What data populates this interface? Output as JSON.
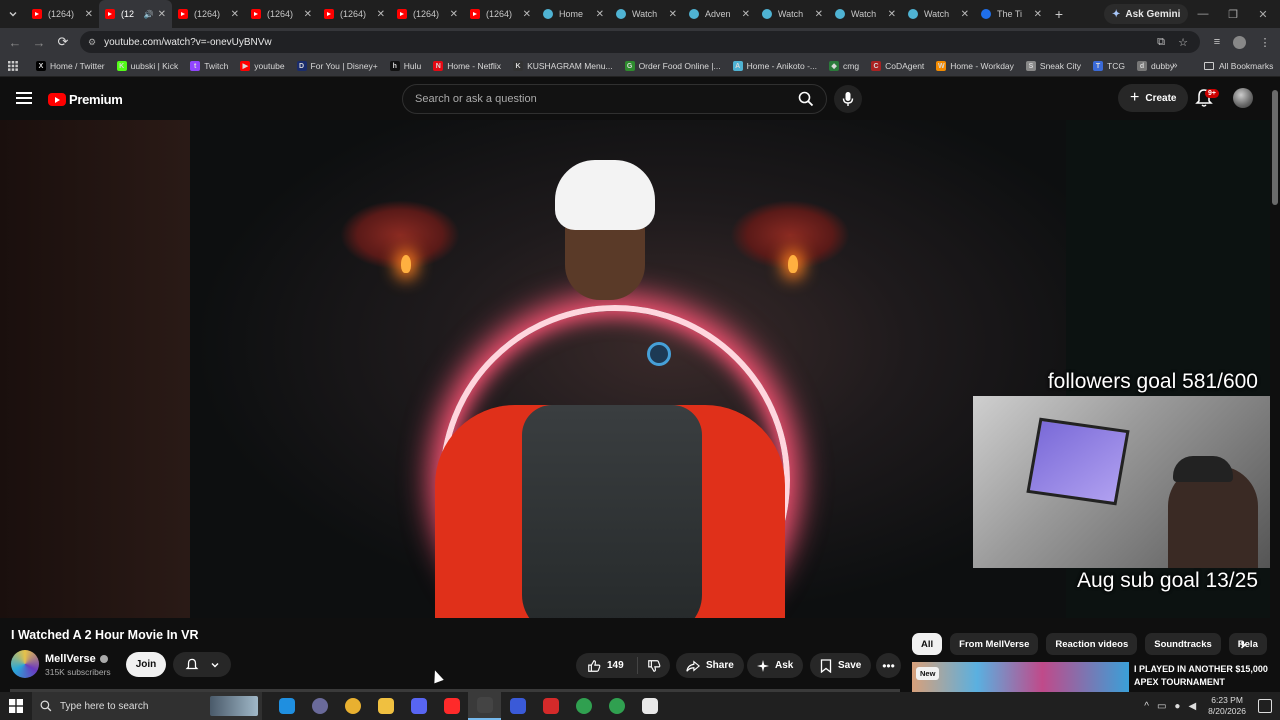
{
  "browser": {
    "tabs": [
      {
        "label": "(1264)",
        "favicon": "youtube-icon",
        "active": false
      },
      {
        "label": "(12",
        "favicon": "youtube-icon",
        "active": true,
        "audio": true
      },
      {
        "label": "(1264)",
        "favicon": "youtube-icon",
        "active": false
      },
      {
        "label": "(1264)",
        "favicon": "youtube-icon",
        "active": false
      },
      {
        "label": "(1264)",
        "favicon": "youtube-icon",
        "active": false
      },
      {
        "label": "(1264)",
        "favicon": "youtube-icon",
        "active": false
      },
      {
        "label": "(1264)",
        "favicon": "youtube-icon",
        "active": false
      },
      {
        "label": "Home",
        "favicon": "watch-icon",
        "active": false
      },
      {
        "label": "Watch",
        "favicon": "watch-icon",
        "active": false
      },
      {
        "label": "Adven",
        "favicon": "watch-icon",
        "active": false
      },
      {
        "label": "Watch",
        "favicon": "watch-icon",
        "active": false
      },
      {
        "label": "Watch",
        "favicon": "watch-icon",
        "active": false
      },
      {
        "label": "Watch",
        "favicon": "watch-icon",
        "active": false
      },
      {
        "label": "The Ti",
        "favicon": "facebook-icon",
        "active": false
      }
    ],
    "new_tab": "+",
    "gemini_label": "Ask Gemini",
    "url": "youtube.com/watch?v=-onevUyBNVw",
    "bookmarks": [
      {
        "label": "Home / Twitter",
        "icon": "x-icon",
        "color": "#000000",
        "glyph": "X"
      },
      {
        "label": "uubski | Kick",
        "icon": "kick-icon",
        "color": "#53fc18",
        "glyph": "K"
      },
      {
        "label": "Twitch",
        "icon": "twitch-icon",
        "color": "#9146ff",
        "glyph": "t"
      },
      {
        "label": "youtube",
        "icon": "youtube-icon",
        "color": "#ff0000",
        "glyph": "▶"
      },
      {
        "label": "For You | Disney+",
        "icon": "disney-icon",
        "color": "#1a2c6b",
        "glyph": "D"
      },
      {
        "label": "Hulu",
        "icon": "hulu-icon",
        "color": "#111111",
        "glyph": "h"
      },
      {
        "label": "Home - Netflix",
        "icon": "netflix-icon",
        "color": "#e50914",
        "glyph": "N"
      },
      {
        "label": "KUSHAGRAM Menu...",
        "icon": "kushagram-icon",
        "color": "#333333",
        "glyph": "K"
      },
      {
        "label": "Order Food Online |...",
        "icon": "grubhub-icon",
        "color": "#2e8b2e",
        "glyph": "G"
      },
      {
        "label": "Home - Anikoto -...",
        "icon": "anikoto-icon",
        "color": "#4fb3d3",
        "glyph": "A"
      },
      {
        "label": "cmg",
        "icon": "cmg-icon",
        "color": "#2a7a3a",
        "glyph": "◆"
      },
      {
        "label": "CoDAgent",
        "icon": "codagent-icon",
        "color": "#aa2222",
        "glyph": "C"
      },
      {
        "label": "Home - Workday",
        "icon": "workday-icon",
        "color": "#f38b00",
        "glyph": "W"
      },
      {
        "label": "Sneak City",
        "icon": "sneakcity-icon",
        "color": "#888888",
        "glyph": "S"
      },
      {
        "label": "TCG",
        "icon": "tcg-icon",
        "color": "#3a6ad8",
        "glyph": "T"
      },
      {
        "label": "dubby",
        "icon": "dubby-icon",
        "color": "#777777",
        "glyph": "d"
      }
    ],
    "all_bookmarks": "All Bookmarks"
  },
  "youtube": {
    "logo_text": "Premium",
    "search_placeholder": "Search or ask a question",
    "create_label": "Create",
    "notification_count": "9+",
    "video": {
      "title": "I Watched A 2 Hour Movie In VR",
      "overlay_top": "followers goal 581/600",
      "overlay_bottom": "Aug sub goal 13/25"
    },
    "channel": {
      "name": "MellVerse",
      "subscribers": "315K subscribers",
      "join_label": "Join"
    },
    "actions": {
      "like_count": "149",
      "share_label": "Share",
      "ask_label": "Ask",
      "save_label": "Save"
    },
    "chips": [
      "All",
      "From MellVerse",
      "Reaction videos",
      "Soundtracks",
      "Rela"
    ],
    "recommendation": {
      "badge": "New",
      "title": "I PLAYED IN ANOTHER $15,000 APEX TOURNAMENT"
    }
  },
  "taskbar": {
    "search_placeholder": "Type here to search",
    "time": "6:23 PM",
    "date": "8/20/2026",
    "apps": [
      {
        "name": "edge-icon",
        "color": "#1f8fe0"
      },
      {
        "name": "chrome-dev-icon",
        "color": "#6a6a9a"
      },
      {
        "name": "chrome-icon",
        "color": "#e8b030"
      },
      {
        "name": "file-explorer-icon",
        "color": "#f0c040"
      },
      {
        "name": "discord-icon",
        "color": "#5865f2"
      },
      {
        "name": "youtube-music-icon",
        "color": "#ff2a2a"
      },
      {
        "name": "obs-icon",
        "color": "#444444",
        "active": true
      },
      {
        "name": "app-icon",
        "color": "#3a5ad8"
      },
      {
        "name": "acrobat-icon",
        "color": "#d42a2a"
      },
      {
        "name": "chrome-icon-2",
        "color": "#30a050"
      },
      {
        "name": "chrome-icon-3",
        "color": "#30a050"
      },
      {
        "name": "clock-app-icon",
        "color": "#e8e8e8"
      }
    ]
  }
}
